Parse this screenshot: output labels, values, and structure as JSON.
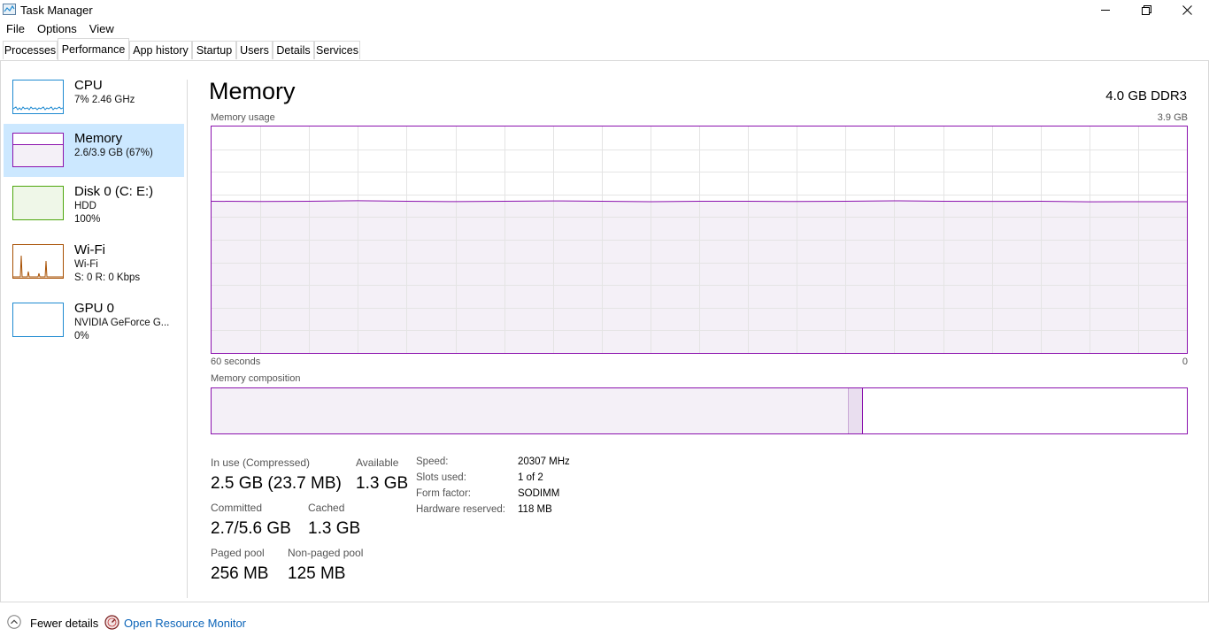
{
  "window": {
    "title": "Task Manager"
  },
  "menu": [
    "File",
    "Options",
    "View"
  ],
  "tabs": [
    "Processes",
    "Performance",
    "App history",
    "Startup",
    "Users",
    "Details",
    "Services"
  ],
  "sidebar": [
    {
      "title": "CPU",
      "line1": "7%  2.46 GHz",
      "line2": ""
    },
    {
      "title": "Memory",
      "line1": "2.6/3.9 GB (67%)",
      "line2": ""
    },
    {
      "title": "Disk 0 (C: E:)",
      "line1": "HDD",
      "line2": "100%"
    },
    {
      "title": "Wi-Fi",
      "line1": "Wi-Fi",
      "line2": "S: 0  R: 0 Kbps"
    },
    {
      "title": "GPU 0",
      "line1": "NVIDIA GeForce G...",
      "line2": "0%"
    }
  ],
  "main": {
    "title": "Memory",
    "spec": "4.0 GB DDR3",
    "usage_label": "Memory usage",
    "usage_max": "3.9 GB",
    "time_left": "60 seconds",
    "time_right": "0",
    "composition_label": "Memory composition"
  },
  "stats": {
    "in_use_label": "In use (Compressed)",
    "in_use_value": "2.5 GB (23.7 MB)",
    "available_label": "Available",
    "available_value": "1.3 GB",
    "committed_label": "Committed",
    "committed_value": "2.7/5.6 GB",
    "cached_label": "Cached",
    "cached_value": "1.3 GB",
    "paged_label": "Paged pool",
    "paged_value": "256 MB",
    "nonpaged_label": "Non-paged pool",
    "nonpaged_value": "125 MB"
  },
  "specs": [
    {
      "label": "Speed:",
      "value": "20307 MHz"
    },
    {
      "label": "Slots used:",
      "value": "1 of 2"
    },
    {
      "label": "Form factor:",
      "value": "SODIMM"
    },
    {
      "label": "Hardware reserved:",
      "value": "118 MB"
    }
  ],
  "footer": {
    "fewer_details": "Fewer details",
    "open_resmon": "Open Resource Monitor"
  },
  "memory_usage_fraction": 0.67,
  "composition": {
    "in_use_fraction": 0.652,
    "modified_fraction": 0.014
  },
  "colors": {
    "memory_accent": "#8b12ae",
    "memory_fill": "#f4f0f7",
    "selection": "#cce8ff",
    "cpu": "#1f8ad1",
    "disk": "#4da60c",
    "wifi": "#a74f01",
    "gpu": "#1f8ad1",
    "link": "#0a63b8"
  }
}
